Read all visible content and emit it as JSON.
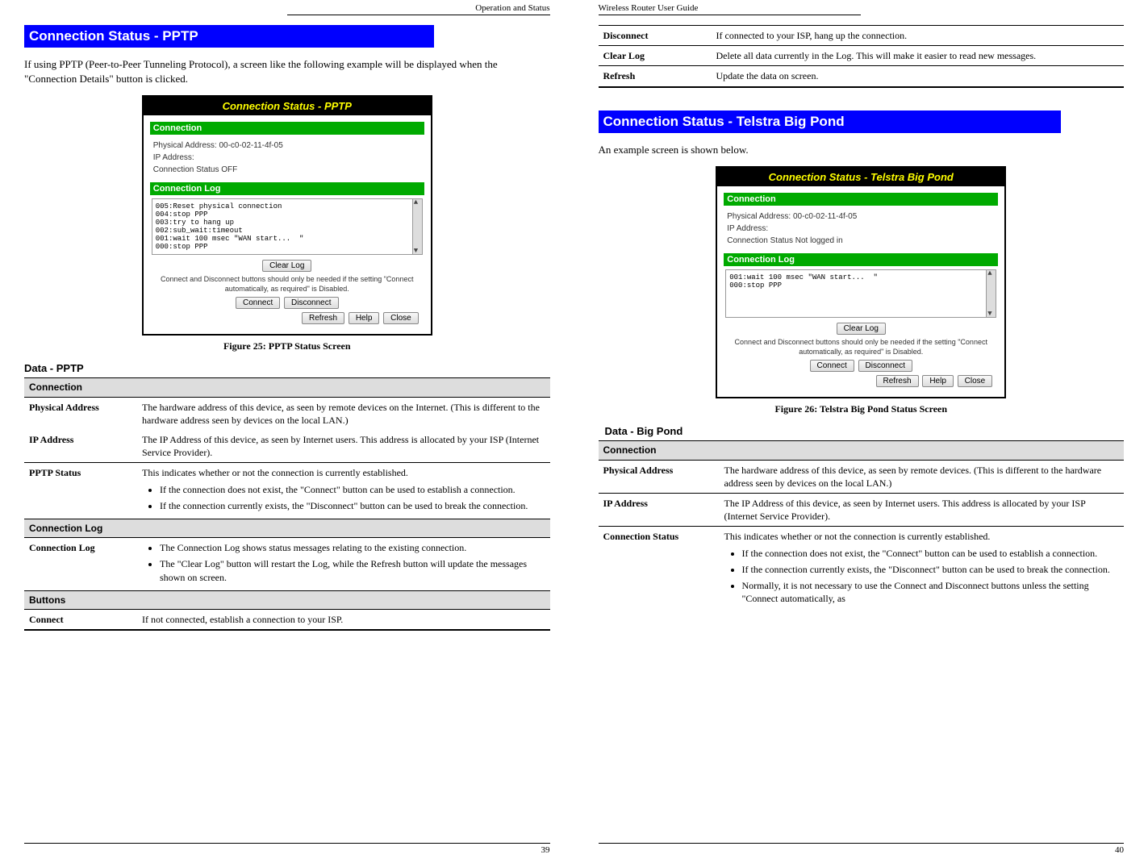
{
  "left_page": {
    "header": "Operation and Status",
    "title_bar": "Connection Status - PPTP",
    "intro": "If using PPTP (Peer-to-Peer Tunneling Protocol), a screen like the following example will be displayed when the \"Connection Details\" button is clicked.",
    "figure_caption": "Figure 25: PPTP Status Screen",
    "data_heading": "Data - PPTP",
    "screenshot": {
      "title": "Connection Status - PPTP",
      "sec_conn": "Connection",
      "phys_label": "Physical Address: 00-c0-02-11-4f-05",
      "ip_label": "IP Address:",
      "status_label": "Connection Status OFF",
      "sec_log": "Connection Log",
      "log_text": "005:Reset physical connection\n004:stop PPP\n003:try to hang up\n002:sub_wait:timeout\n001:wait 100 msec \"WAN start...  \"\n000:stop PPP",
      "clear_log_btn": "Clear Log",
      "note": "Connect and Disconnect buttons should only be needed if the setting \"Connect automatically, as required\" is Disabled.",
      "connect_btn": "Connect",
      "disconnect_btn": "Disconnect",
      "refresh_btn": "Refresh",
      "help_btn": "Help",
      "close_btn": "Close"
    },
    "sections": {
      "connection": "Connection",
      "connection_log": "Connection Log",
      "buttons": "Buttons"
    },
    "rows": {
      "phys_addr_label": "Physical Address",
      "phys_addr_desc": "The hardware address of this device, as seen by remote devices on the Internet. (This is different to the hardware address seen by devices on the local LAN.)",
      "ip_addr_label": "IP Address",
      "ip_addr_desc": "The IP Address of this device, as seen by Internet users. This address is allocated by your ISP (Internet Service Provider).",
      "pptp_status_label": "PPTP Status",
      "pptp_status_desc": "This indicates whether or not the connection is currently established.",
      "pptp_bullet1": "If the connection does not exist, the \"Connect\" button can be used to establish a connection.",
      "pptp_bullet2": "If the connection currently exists, the \"Disconnect\" button can be used to break the connection.",
      "conn_log_label": "Connection Log",
      "conn_log_bullet1": "The Connection Log shows status messages relating to the existing connection.",
      "conn_log_bullet2": "The \"Clear Log\" button will restart the Log, while the Refresh button will update the messages shown on screen.",
      "connect_label": "Connect",
      "connect_desc": "If not connected, establish a connection to your ISP."
    },
    "page_num": "39"
  },
  "right_page": {
    "header": "Wireless Router User Guide",
    "top_rows": {
      "disconnect_label": "Disconnect",
      "disconnect_desc": "If connected to your ISP, hang up the connection.",
      "clearlog_label": "Clear Log",
      "clearlog_desc": "Delete all data currently in the Log. This will make it easier to read new messages.",
      "refresh_label": "Refresh",
      "refresh_desc": "Update the data on screen."
    },
    "title_bar": "Connection Status - Telstra Big Pond",
    "intro": "An example screen is shown below.",
    "figure_caption": "Figure 26: Telstra Big Pond Status Screen",
    "data_heading": "Data - Big Pond",
    "screenshot": {
      "title": "Connection Status - Telstra Big Pond",
      "sec_conn": "Connection",
      "phys_label": "Physical Address: 00-c0-02-11-4f-05",
      "ip_label": "IP Address:",
      "status_label": "Connection Status  Not logged in",
      "sec_log": "Connection Log",
      "log_text": "001:wait 100 msec \"WAN start...  \"\n000:stop PPP",
      "clear_log_btn": "Clear Log",
      "note": "Connect and Disconnect buttons should only be needed if the setting \"Connect automatically, as required\" is Disabled.",
      "connect_btn": "Connect",
      "disconnect_btn": "Disconnect",
      "refresh_btn": "Refresh",
      "help_btn": "Help",
      "close_btn": "Close"
    },
    "sections": {
      "connection": "Connection"
    },
    "rows": {
      "phys_addr_label": "Physical Address",
      "phys_addr_desc": "The hardware address of this device, as seen by remote devices. (This is different to the hardware address seen by devices on the local LAN.)",
      "ip_addr_label": "IP Address",
      "ip_addr_desc": "The IP Address of this device, as seen by Internet users. This address is allocated by your ISP (Internet Service Provider).",
      "conn_status_label": "Connection Status",
      "conn_status_desc": "This indicates whether or not the connection is currently established.",
      "conn_bullet1": "If the connection does not exist, the \"Connect\" button can be used to establish a connection.",
      "conn_bullet2": "If the connection currently exists, the \"Disconnect\" button can be used to break the connection.",
      "conn_bullet3": "Normally, it is not necessary to use the Connect and Disconnect buttons unless the setting \"Connect automatically, as"
    },
    "page_num": "40"
  }
}
